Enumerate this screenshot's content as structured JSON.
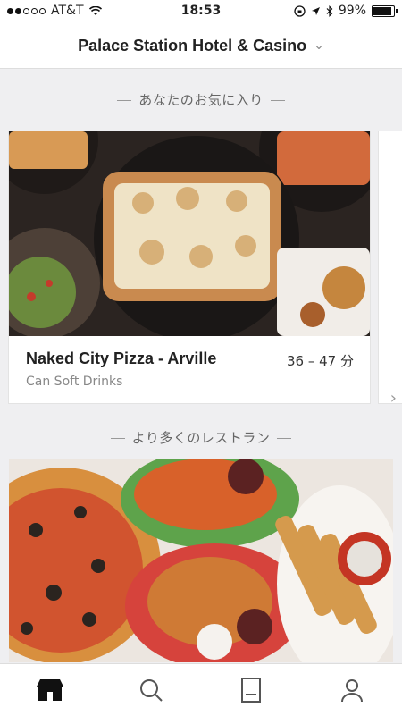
{
  "status": {
    "carrier": "AT&T",
    "time": "18:53",
    "battery": "99%"
  },
  "header": {
    "location": "Palace Station Hotel & Casino",
    "chevron": "chevron-down-icon"
  },
  "favorites": {
    "title": "あなたのお気に入り",
    "card": {
      "name": "Naked City Pizza - Arville",
      "eta": "36 – 47 分",
      "subtitle": "Can Soft Drinks"
    }
  },
  "more": {
    "title": "より多くのレストラン"
  },
  "tabs": [
    {
      "icon": "home-icon",
      "active": true
    },
    {
      "icon": "search-icon",
      "active": false
    },
    {
      "icon": "receipt-icon",
      "active": false
    },
    {
      "icon": "profile-icon",
      "active": false
    }
  ]
}
